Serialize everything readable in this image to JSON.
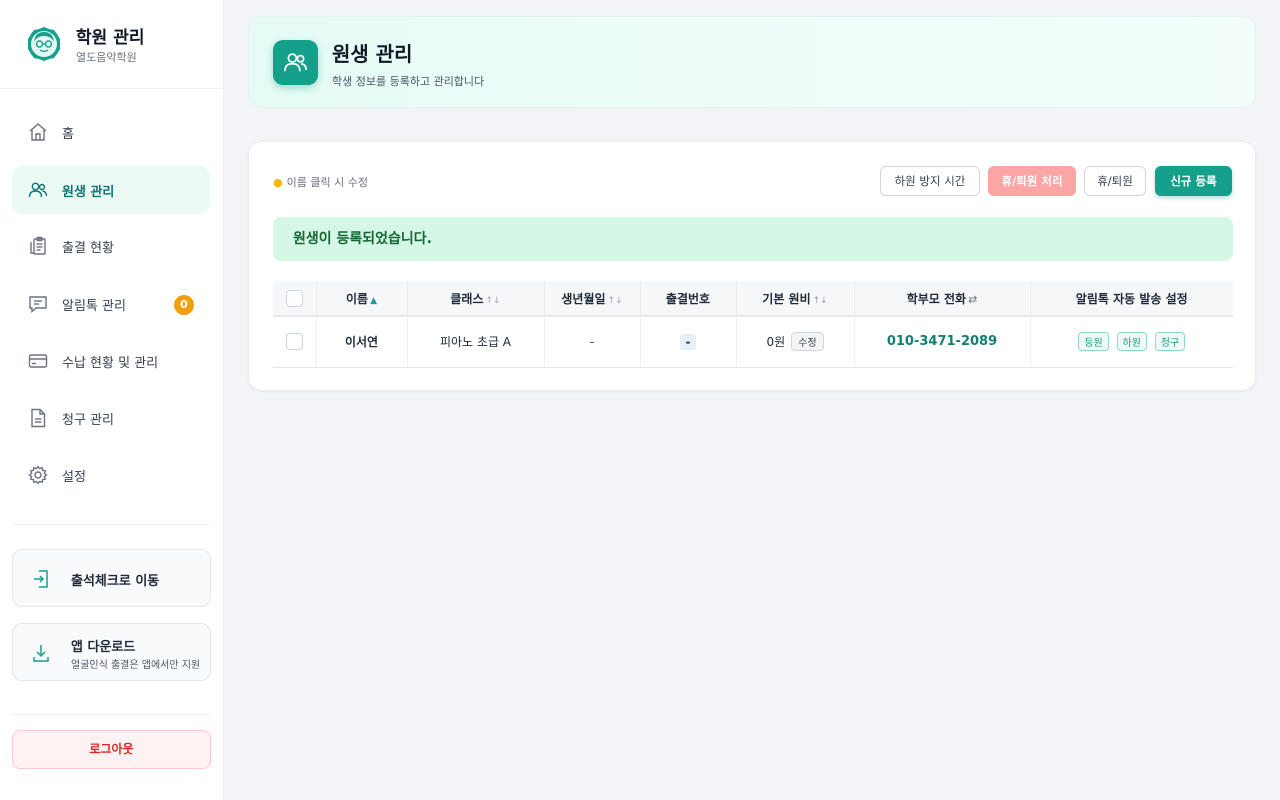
{
  "sidebar": {
    "brand_title": "학원 관리",
    "brand_subtitle": "열도음악학원",
    "items": [
      {
        "label": "홈",
        "icon": "home-icon"
      },
      {
        "label": "원생 관리",
        "icon": "users-icon",
        "active": true
      },
      {
        "label": "출결 현황",
        "icon": "clipboard-icon"
      },
      {
        "label": "알림톡 관리",
        "icon": "chat-icon",
        "badge": "0"
      },
      {
        "label": "수납 현황 및 관리",
        "icon": "card-icon"
      },
      {
        "label": "청구 관리",
        "icon": "document-icon"
      },
      {
        "label": "설정",
        "icon": "gear-icon"
      }
    ],
    "attendance_card": {
      "title": "출석체크로 이동",
      "icon": "login-icon"
    },
    "app_card": {
      "title": "앱 다운로드",
      "subtitle": "얼굴인식 출결은 앱에서만 지원",
      "icon": "download-icon"
    },
    "logout_label": "로그아웃"
  },
  "header": {
    "title": "원생 관리",
    "subtitle": "학생 정보를 등록하고 관리합니다"
  },
  "toolbar": {
    "hint": "이름 클릭 시 수정",
    "dismissal_time_label": "하원 방지 시간",
    "leave_process_label": "휴/퇴원 처리",
    "leave_label": "휴/퇴원",
    "new_register_label": "신규 등록"
  },
  "alert": {
    "message": "원생이 등록되었습니다."
  },
  "table": {
    "headers": {
      "name": "이름",
      "class": "클래스",
      "birth": "생년월일",
      "attendance_no": "출결번호",
      "fee": "기본 원비",
      "parent_phone": "학부모 전화",
      "notify": "알림톡 자동 발송 설정"
    },
    "rows": [
      {
        "name": "이서연",
        "class": "피아노 초급 A",
        "birth": "-",
        "attendance_no": "-",
        "fee": "0원",
        "fee_edit": "수정",
        "parent_phone": "010-3471-2089",
        "tags": [
          "등원",
          "하원",
          "청구"
        ]
      }
    ]
  },
  "colors": {
    "accent": "#14a08a",
    "alert_bg": "#d4f7e6",
    "danger": "#dc2626",
    "badge": "#f59e0b"
  }
}
